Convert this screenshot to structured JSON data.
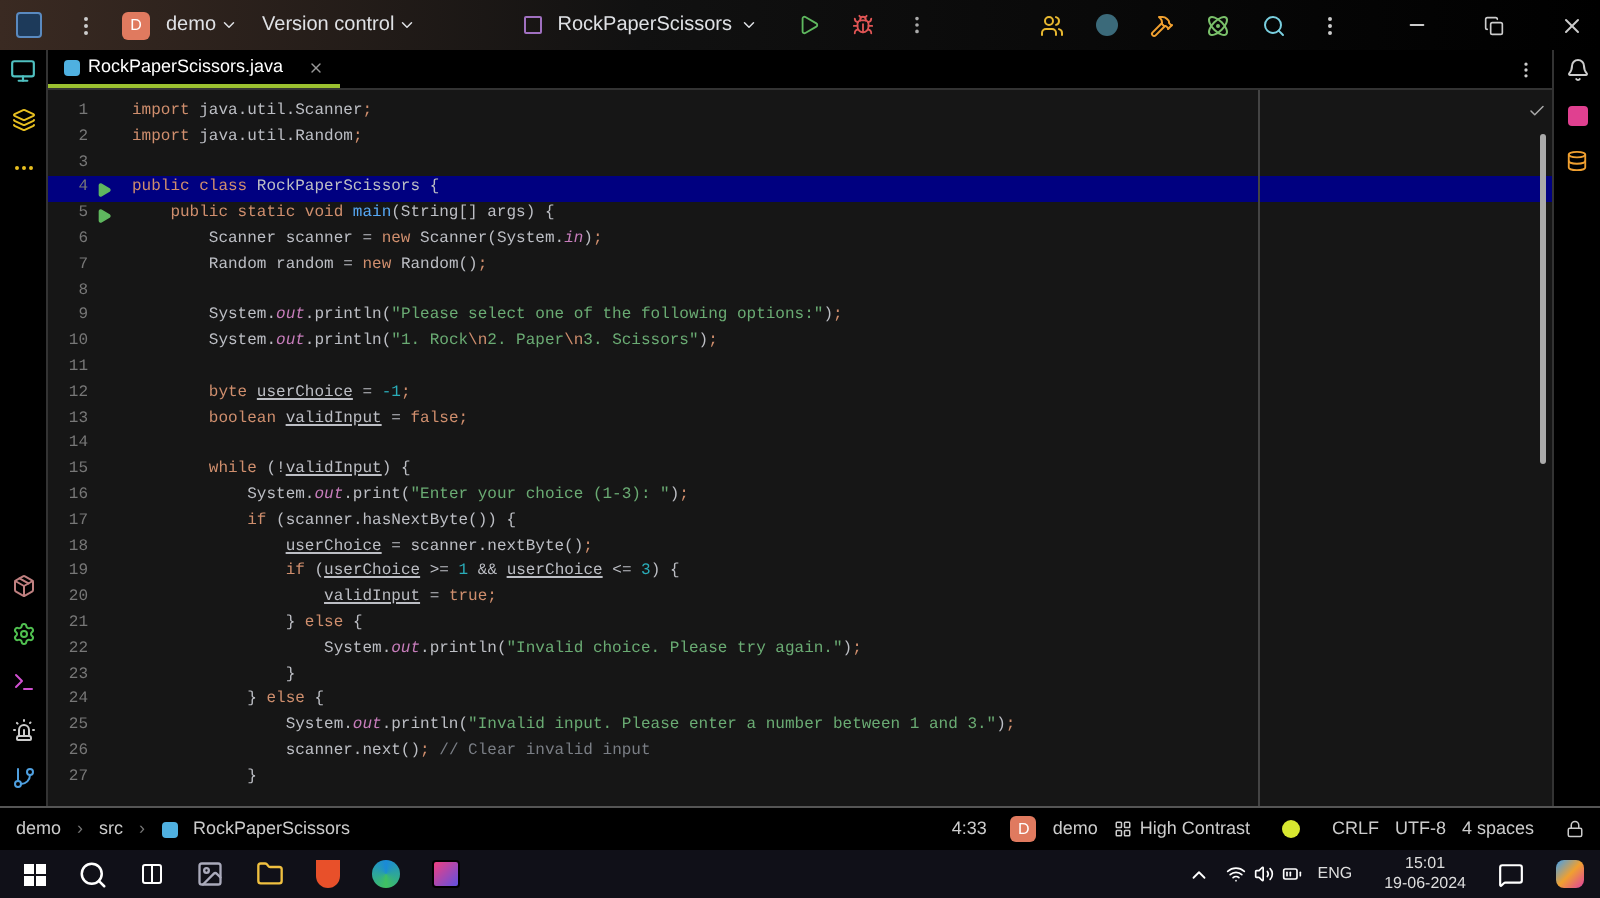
{
  "title_bar": {
    "project_badge": "D",
    "project": "demo",
    "vcs": "Version control",
    "run_config": "RockPaperScissors"
  },
  "tabs": [
    {
      "label": "RockPaperScissors.java",
      "selected": true
    }
  ],
  "editor": {
    "lines": [
      {
        "number": "1",
        "run": false,
        "highlighted": false,
        "tokens": [
          {
            "kind": "kw",
            "text": "import"
          },
          {
            "kind": "plain",
            "text": " java.util.Scanner"
          },
          {
            "kind": "punct",
            "text": ";"
          }
        ]
      },
      {
        "number": "2",
        "run": false,
        "highlighted": false,
        "tokens": [
          {
            "kind": "kw",
            "text": "import"
          },
          {
            "kind": "plain",
            "text": " java.util.Random"
          },
          {
            "kind": "punct",
            "text": ";"
          }
        ]
      },
      {
        "number": "3",
        "run": false,
        "highlighted": false
      },
      {
        "number": "4",
        "run": true,
        "highlighted": true,
        "tokens": [
          {
            "kind": "kw",
            "text": "public class "
          },
          {
            "kind": "plain",
            "text": "RockPaperScissors "
          },
          {
            "kind": "plain",
            "text": "{"
          }
        ]
      },
      {
        "number": "5",
        "run": true,
        "highlighted": false,
        "tokens": [
          {
            "kind": "kw",
            "text": "    public static void "
          },
          {
            "kind": "method",
            "text": "main"
          },
          {
            "kind": "plain",
            "text": "(String[] args) {"
          }
        ]
      },
      {
        "number": "6",
        "run": false,
        "highlighted": false,
        "tokens": [
          {
            "kind": "plain",
            "text": "        Scanner scanner = "
          },
          {
            "kind": "kw",
            "text": "new"
          },
          {
            "kind": "plain",
            "text": " Scanner(System."
          },
          {
            "kind": "field",
            "text": "in"
          },
          {
            "kind": "plain",
            "text": ")"
          },
          {
            "kind": "punct",
            "text": ";"
          }
        ]
      },
      {
        "number": "7",
        "run": false,
        "highlighted": false,
        "tokens": [
          {
            "kind": "plain",
            "text": "        Random random = "
          },
          {
            "kind": "kw",
            "text": "new"
          },
          {
            "kind": "plain",
            "text": " Random()"
          },
          {
            "kind": "punct",
            "text": ";"
          }
        ]
      },
      {
        "number": "8",
        "run": false,
        "highlighted": false
      },
      {
        "number": "9",
        "run": false,
        "highlighted": false,
        "tokens": [
          {
            "kind": "plain",
            "text": "        System."
          },
          {
            "kind": "field",
            "text": "out"
          },
          {
            "kind": "plain",
            "text": ".println("
          },
          {
            "kind": "str",
            "text": "\"Please select one of the following options:\""
          },
          {
            "kind": "plain",
            "text": ")"
          },
          {
            "kind": "punct",
            "text": ";"
          }
        ]
      },
      {
        "number": "10",
        "run": false,
        "highlighted": false,
        "tokens": [
          {
            "kind": "plain",
            "text": "        System."
          },
          {
            "kind": "field",
            "text": "out"
          },
          {
            "kind": "plain",
            "text": ".println("
          },
          {
            "kind": "str",
            "text": "\"1. Rock"
          },
          {
            "kind": "punct",
            "text": "\\n"
          },
          {
            "kind": "str",
            "text": "2. Paper"
          },
          {
            "kind": "punct",
            "text": "\\n"
          },
          {
            "kind": "str",
            "text": "3. Scissors\""
          },
          {
            "kind": "plain",
            "text": ")"
          },
          {
            "kind": "punct",
            "text": ";"
          }
        ]
      },
      {
        "number": "11",
        "run": false,
        "highlighted": false
      },
      {
        "number": "12",
        "run": false,
        "highlighted": false,
        "tokens": [
          {
            "kind": "kw",
            "text": "        byte "
          },
          {
            "kind": "var",
            "text": "userChoice"
          },
          {
            "kind": "plain",
            "text": " = "
          },
          {
            "kind": "num",
            "text": "-1"
          },
          {
            "kind": "punct",
            "text": ";"
          }
        ]
      },
      {
        "number": "13",
        "run": false,
        "highlighted": false,
        "tokens": [
          {
            "kind": "kw",
            "text": "        boolean "
          },
          {
            "kind": "var",
            "text": "validInput"
          },
          {
            "kind": "plain",
            "text": " = "
          },
          {
            "kind": "kw",
            "text": "false"
          },
          {
            "kind": "punct",
            "text": ";"
          }
        ]
      },
      {
        "number": "14",
        "run": false,
        "highlighted": false
      },
      {
        "number": "15",
        "run": false,
        "highlighted": false,
        "tokens": [
          {
            "kind": "kw",
            "text": "        while"
          },
          {
            "kind": "plain",
            "text": " (!"
          },
          {
            "kind": "var",
            "text": "validInput"
          },
          {
            "kind": "plain",
            "text": ") {"
          }
        ]
      },
      {
        "number": "16",
        "run": false,
        "highlighted": false,
        "tokens": [
          {
            "kind": "plain",
            "text": "            System."
          },
          {
            "kind": "field",
            "text": "out"
          },
          {
            "kind": "plain",
            "text": ".print("
          },
          {
            "kind": "str",
            "text": "\"Enter your choice (1-3): \""
          },
          {
            "kind": "plain",
            "text": ")"
          },
          {
            "kind": "punct",
            "text": ";"
          }
        ]
      },
      {
        "number": "17",
        "run": false,
        "highlighted": false,
        "tokens": [
          {
            "kind": "kw",
            "text": "            if"
          },
          {
            "kind": "plain",
            "text": " (scanner.hasNextByte()) {"
          }
        ]
      },
      {
        "number": "18",
        "run": false,
        "highlighted": false,
        "tokens": [
          {
            "kind": "var",
            "text": "                userChoice"
          },
          {
            "kind": "plain",
            "text": " = scanner.nextByte()"
          },
          {
            "kind": "punct",
            "text": ";"
          }
        ]
      },
      {
        "number": "19",
        "run": false,
        "highlighted": false,
        "tokens": [
          {
            "kind": "kw",
            "text": "                if"
          },
          {
            "kind": "plain",
            "text": " ("
          },
          {
            "kind": "var",
            "text": "userChoice"
          },
          {
            "kind": "plain",
            "text": " >= "
          },
          {
            "kind": "num",
            "text": "1"
          },
          {
            "kind": "plain",
            "text": " && "
          },
          {
            "kind": "var",
            "text": "userChoice"
          },
          {
            "kind": "plain",
            "text": " <= "
          },
          {
            "kind": "num",
            "text": "3"
          },
          {
            "kind": "plain",
            "text": ") {"
          }
        ]
      },
      {
        "number": "20",
        "run": false,
        "highlighted": false,
        "tokens": [
          {
            "kind": "var",
            "text": "                    validInput"
          },
          {
            "kind": "plain",
            "text": " = "
          },
          {
            "kind": "kw",
            "text": "true"
          },
          {
            "kind": "punct",
            "text": ";"
          }
        ]
      },
      {
        "number": "21",
        "run": false,
        "highlighted": false,
        "tokens": [
          {
            "kind": "plain",
            "text": "                } "
          },
          {
            "kind": "kw",
            "text": "else"
          },
          {
            "kind": "plain",
            "text": " {"
          }
        ]
      },
      {
        "number": "22",
        "run": false,
        "highlighted": false,
        "tokens": [
          {
            "kind": "plain",
            "text": "                    System."
          },
          {
            "kind": "field",
            "text": "out"
          },
          {
            "kind": "plain",
            "text": ".println("
          },
          {
            "kind": "str",
            "text": "\"Invalid choice. Please try again.\""
          },
          {
            "kind": "plain",
            "text": ")"
          },
          {
            "kind": "punct",
            "text": ";"
          }
        ]
      },
      {
        "number": "23",
        "run": false,
        "highlighted": false,
        "tokens": [
          {
            "kind": "plain",
            "text": "                }"
          }
        ]
      },
      {
        "number": "24",
        "run": false,
        "highlighted": false,
        "tokens": [
          {
            "kind": "plain",
            "text": "            } "
          },
          {
            "kind": "kw",
            "text": "else"
          },
          {
            "kind": "plain",
            "text": " {"
          }
        ]
      },
      {
        "number": "25",
        "run": false,
        "highlighted": false,
        "tokens": [
          {
            "kind": "plain",
            "text": "                System."
          },
          {
            "kind": "field",
            "text": "out"
          },
          {
            "kind": "plain",
            "text": ".println("
          },
          {
            "kind": "str",
            "text": "\"Invalid input. Please enter a number between 1 and 3.\""
          },
          {
            "kind": "plain",
            "text": ")"
          },
          {
            "kind": "punct",
            "text": ";"
          }
        ]
      },
      {
        "number": "26",
        "run": false,
        "highlighted": false,
        "tokens": [
          {
            "kind": "plain",
            "text": "                scanner.next()"
          },
          {
            "kind": "punct",
            "text": ";"
          },
          {
            "kind": "comment",
            "text": " // Clear invalid input"
          }
        ]
      },
      {
        "number": "27",
        "run": false,
        "highlighted": false,
        "tokens": [
          {
            "kind": "plain",
            "text": "            }"
          }
        ]
      }
    ]
  },
  "breadcrumbs": [
    "demo",
    "src",
    "RockPaperScissors"
  ],
  "breadcrumb_separator": "›",
  "status_bar": {
    "position": "4:33",
    "project_badge": "D",
    "project": "demo",
    "theme": "High Contrast",
    "line_separator": "CRLF",
    "encoding": "UTF-8",
    "indent": "4 spaces"
  },
  "taskbar": {
    "language": "ENG",
    "time": "15:01",
    "date": "19-06-2024"
  }
}
